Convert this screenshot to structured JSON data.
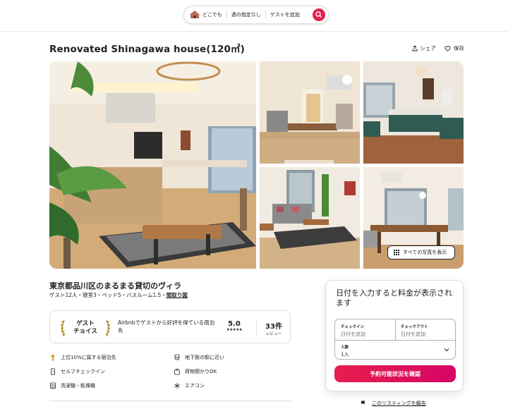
{
  "search": {
    "anywhere": "どこでも",
    "anyweek": "週の指定なし",
    "add_guests": "ゲストを追加"
  },
  "listing": {
    "title": "Renovated Shinagawa house(120㎡)",
    "share_label": "シェア",
    "save_label": "保存",
    "show_all_photos": "すべての写真を表示",
    "location_title": "東京都品川区のまるまる貸切のヴィラ",
    "specs_text": "ゲスト12人・寝室3・ベッド5・バスルーム1.5・",
    "floorplan_link": "間取り図"
  },
  "guest_favorite": {
    "badge_line1": "ゲスト",
    "badge_line2": "チョイス",
    "description": "Airbnbでゲストから好評を得ている宿泊先",
    "rating": "5.0",
    "stars": "★★★★★",
    "review_count": "33件",
    "review_label": "レビュー"
  },
  "amenities": [
    {
      "icon": "trophy-icon",
      "label": "上位10%に属する宿泊先"
    },
    {
      "icon": "subway-icon",
      "label": "地下鉄の駅に近い"
    },
    {
      "icon": "door-icon",
      "label": "セルフチェックイン"
    },
    {
      "icon": "luggage-icon",
      "label": "荷物預かりOK"
    },
    {
      "icon": "washer-icon",
      "label": "洗濯機・乾燥機"
    },
    {
      "icon": "snowflake-icon",
      "label": "エアコン"
    }
  ],
  "booking": {
    "headline": "日付を入力すると料金が表示されます",
    "checkin_label": "チェックイン",
    "checkin_placeholder": "日付を追加",
    "checkout_label": "チェックアウト",
    "checkout_placeholder": "日付を追加",
    "guests_label": "人数",
    "guests_value": "1人",
    "cta": "予約可能状況を確認"
  },
  "report_link": "このリスティングを報告",
  "colors": {
    "brand": "#e61e4d",
    "brand_dark": "#d70466",
    "text": "#222222",
    "muted": "#717171",
    "border": "#dddddd"
  }
}
